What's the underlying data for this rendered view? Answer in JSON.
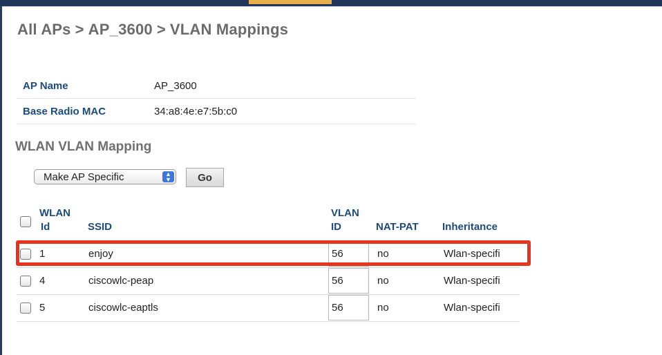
{
  "breadcrumb": {
    "items": [
      "All APs",
      "AP_3600",
      "VLAN Mappings"
    ],
    "separator": ">"
  },
  "ap_info": {
    "ap_name_label": "AP Name",
    "ap_name_value": "AP_3600",
    "base_radio_mac_label": "Base Radio MAC",
    "base_radio_mac_value": "34:a8:4e:e7:5b:c0"
  },
  "section_title": "WLAN VLAN Mapping",
  "action": {
    "selected": "Make AP Specific",
    "go_label": "Go"
  },
  "table": {
    "headers": {
      "wlan_id_line1": "WLAN",
      "wlan_id_line2": "Id",
      "ssid": "SSID",
      "vlan_id_line1": "VLAN",
      "vlan_id_line2": "ID",
      "nat_pat": "NAT-PAT",
      "inheritance": "Inheritance"
    },
    "rows": [
      {
        "wlan_id": "1",
        "ssid": "enjoy",
        "vlan_id": "56",
        "nat_pat": "no",
        "inheritance": "Wlan-specifi"
      },
      {
        "wlan_id": "4",
        "ssid": "ciscowlc-peap",
        "vlan_id": "56",
        "nat_pat": "no",
        "inheritance": "Wlan-specifi"
      },
      {
        "wlan_id": "5",
        "ssid": "ciscowlc-eaptls",
        "vlan_id": "56",
        "nat_pat": "no",
        "inheritance": "Wlan-specifi"
      }
    ]
  },
  "colors": {
    "link_blue": "#1c4a7c",
    "highlight_red": "#e8341c",
    "frame_navy": "#1f3559",
    "accent_gold": "#e9b04a"
  }
}
